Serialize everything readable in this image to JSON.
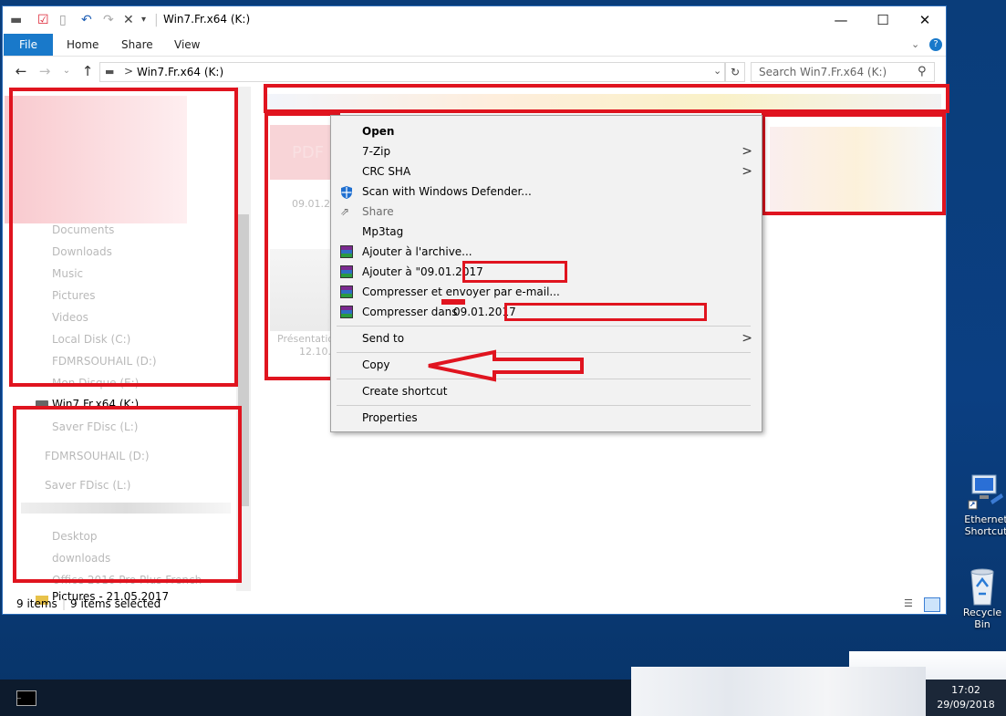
{
  "window": {
    "title": "Win7.Fr.x64 (K:)",
    "controls": {
      "minimize": "—",
      "maximize": "☐",
      "close": "✕"
    }
  },
  "ribbon": {
    "tabs": [
      "File",
      "Home",
      "Share",
      "View"
    ]
  },
  "address": {
    "path": "Win7.Fr.x64 (K:)",
    "breadcrumb_sep": ">"
  },
  "search": {
    "placeholder": "Search Win7.Fr.x64 (K:)"
  },
  "navpane": {
    "items": [
      {
        "label": "Documents",
        "faded": true
      },
      {
        "label": "Downloads",
        "faded": true
      },
      {
        "label": "Music",
        "faded": true
      },
      {
        "label": "Pictures",
        "faded": true
      },
      {
        "label": "Videos",
        "faded": true
      },
      {
        "label": "Local Disk (C:)",
        "faded": true
      },
      {
        "label": "FDMRSOUHAIL (D:)",
        "faded": true
      },
      {
        "label": "Mon Disque (E:)",
        "faded": true
      },
      {
        "label": "Win7.Fr.x64 (K:)",
        "faded": false
      },
      {
        "label": "Saver FDisc (L:)",
        "faded": true
      },
      {
        "label": "FDMRSOUHAIL (D:)",
        "faded": true
      },
      {
        "label": "Saver FDisc (L:)",
        "faded": true
      },
      {
        "label": "Desktop",
        "faded": true
      },
      {
        "label": "downloads",
        "faded": true
      },
      {
        "label": "Office 2016 Pro Plus French",
        "faded": true
      },
      {
        "label": "Pictures - 21.05.2017",
        "faded": false
      }
    ]
  },
  "content": {
    "labels": [
      "PDF",
      "09.01.20",
      "Présentation",
      "12.10.1"
    ]
  },
  "status": {
    "count": "9 items",
    "selected": "9 items selected"
  },
  "context_menu": {
    "items": [
      {
        "label": "Open",
        "bold": true,
        "icon": "none"
      },
      {
        "label": "7-Zip",
        "icon": "none",
        "submenu": true
      },
      {
        "label": "CRC SHA",
        "icon": "none",
        "submenu": true
      },
      {
        "label": "Scan with Windows Defender...",
        "icon": "defender-shield-icon"
      },
      {
        "label": "Share",
        "icon": "share-icon",
        "disabled": true
      },
      {
        "label": "Mp3tag",
        "icon": "none"
      },
      {
        "label": "Ajouter à l'archive...",
        "icon": "winrar-icon"
      },
      {
        "label": "Ajouter à \"09.01.2017",
        "icon": "winrar-icon"
      },
      {
        "label": "Compresser et envoyer par e-mail...",
        "icon": "winrar-icon"
      },
      {
        "label": "Compresser dans",
        "label2": "09.01.2017",
        "icon": "winrar-icon"
      },
      {
        "label": "Send to",
        "icon": "none",
        "submenu": true
      },
      {
        "label": "Copy",
        "icon": "none"
      },
      {
        "label": "Create shortcut",
        "icon": "none"
      },
      {
        "label": "Properties",
        "icon": "none"
      }
    ],
    "submenu_arrow": ">"
  },
  "desktop": {
    "icons": [
      {
        "label": "Ethernet Shortcut",
        "icon": "network-icon"
      },
      {
        "label": "Recycle Bin",
        "icon": "recycle-bin-icon"
      }
    ]
  },
  "taskbar": {
    "time": "17:02",
    "date": "29/09/2018"
  },
  "colors": {
    "accent": "#1979ca",
    "annotation_red": "#e0141f",
    "desktop_blue": "#0b3f82"
  }
}
